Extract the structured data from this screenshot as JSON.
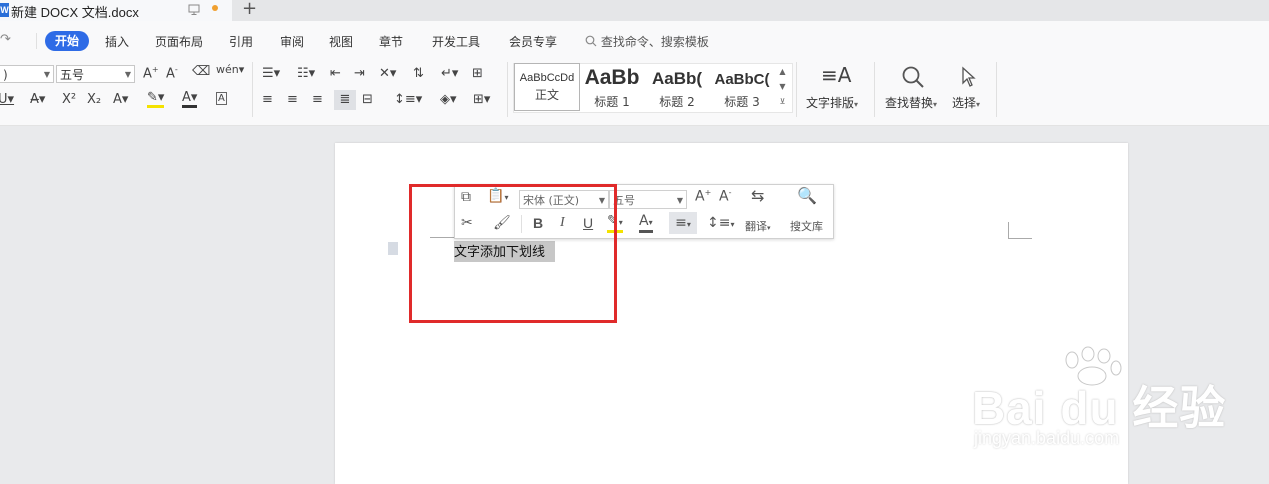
{
  "titlebar": {
    "app_icon": "W",
    "tab_title": "新建 DOCX 文档.docx",
    "new_tab_icon": "+"
  },
  "menu": {
    "start": "开始",
    "insert": "插入",
    "layout": "页面布局",
    "references": "引用",
    "review": "审阅",
    "view": "视图",
    "chapter": "章节",
    "dev_tools": "开发工具",
    "member": "会员专享",
    "search_placeholder": "查找命令、搜索模板"
  },
  "ribbon": {
    "font_size": "五号",
    "styles": [
      {
        "sample": "AaBbCcDd",
        "label": "正文"
      },
      {
        "sample": "AaBb",
        "label": "标题 1"
      },
      {
        "sample": "AaBb(",
        "label": "标题 2"
      },
      {
        "sample": "AaBbC(",
        "label": "标题 3"
      }
    ],
    "text_layout": "文字排版",
    "find_replace": "查找替换",
    "select": "选择"
  },
  "mini_toolbar": {
    "font_name": "宋体 (正文)",
    "font_size": "五号",
    "translate": "翻译",
    "search_lib": "搜文库",
    "bold": "B",
    "italic": "I",
    "underline": "U"
  },
  "document": {
    "selected_text": "文字添加下划线"
  },
  "watermark": {
    "logo_text": "Bai  du 经验",
    "url": "jingyan.baidu.com"
  },
  "colors": {
    "accent": "#2e6be6",
    "highlight_box": "#e02a2a",
    "modified_dot": "#f0a030"
  }
}
